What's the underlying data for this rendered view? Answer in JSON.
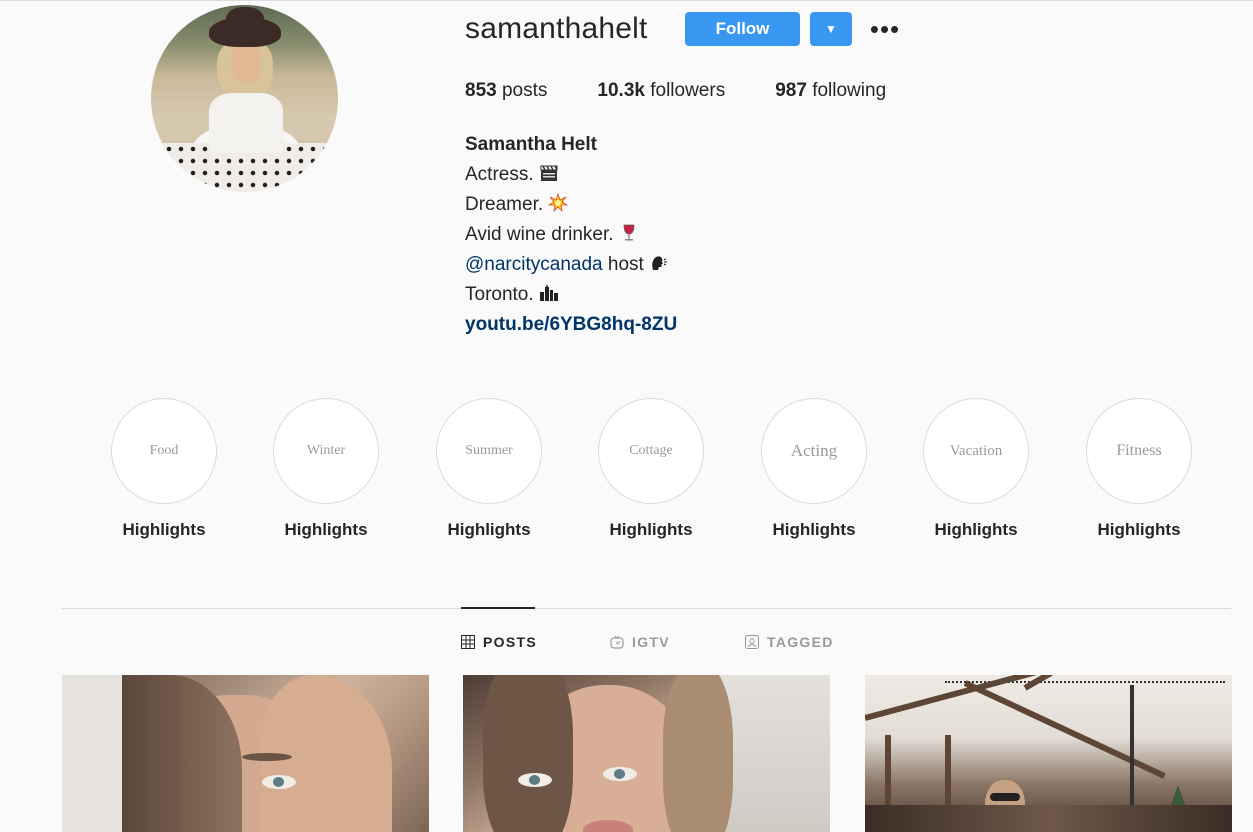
{
  "profile": {
    "username": "samanthahelt",
    "follow_label": "Follow",
    "more_label": "•••",
    "dropdown_glyph": "▼"
  },
  "stats": {
    "posts_count": "853",
    "posts_label": "posts",
    "followers_count": "10.3k",
    "followers_label": "followers",
    "following_count": "987",
    "following_label": "following"
  },
  "bio": {
    "name": "Samantha Helt",
    "line1": "Actress.",
    "line2": "Dreamer.",
    "line3": "Avid wine drinker.",
    "mention": "@narcitycanada",
    "line4_rest": " host",
    "line5": "Toronto.",
    "link": "youtu.be/6YBG8hq-8ZU",
    "emoji_names": [
      "clapper-board-icon",
      "collision-icon",
      "wine-glass-icon",
      "speaking-head-icon",
      "cityscape-icon"
    ]
  },
  "highlights": [
    {
      "cover": "Food",
      "label": "Highlights"
    },
    {
      "cover": "Winter",
      "label": "Highlights"
    },
    {
      "cover": "Summer",
      "label": "Highlights"
    },
    {
      "cover": "Cottage",
      "label": "Highlights"
    },
    {
      "cover": "Acting",
      "label": "Highlights"
    },
    {
      "cover": "Vacation",
      "label": "Highlights"
    },
    {
      "cover": "Fitness",
      "label": "Highlights"
    }
  ],
  "tabs": [
    {
      "label": "POSTS",
      "icon": "grid-icon",
      "active": true
    },
    {
      "label": "IGTV",
      "icon": "igtv-icon",
      "active": false
    },
    {
      "label": "TAGGED",
      "icon": "tagged-icon",
      "active": false
    }
  ],
  "colors": {
    "accent": "#3897f0",
    "link": "#003569",
    "text": "#262626",
    "muted": "#999999",
    "background": "#fafafa"
  }
}
